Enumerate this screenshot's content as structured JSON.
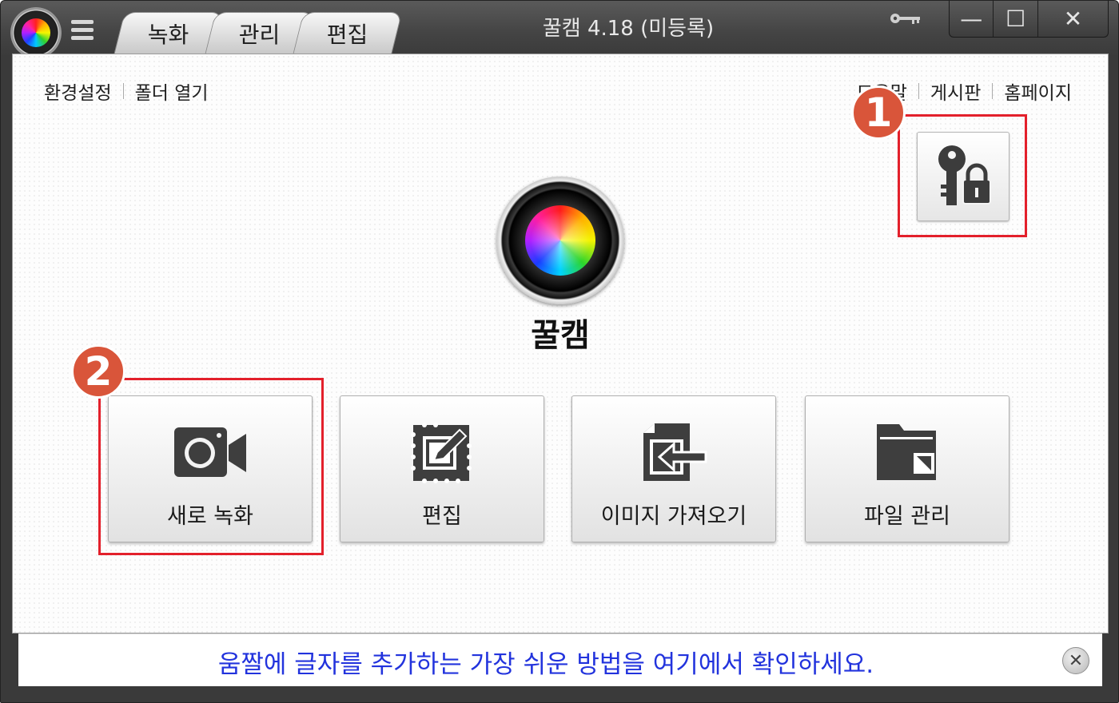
{
  "window": {
    "title": "꿀캠 4.18 (미등록)",
    "tabs": [
      "녹화",
      "관리",
      "편집"
    ],
    "caption": {
      "minimize": "—",
      "maximize": "☐",
      "close": "✕"
    }
  },
  "links": {
    "left": [
      "환경설정",
      "폴더 열기"
    ],
    "right": [
      "도움말",
      "게시판",
      "홈페이지"
    ]
  },
  "app_name": "꿀캠",
  "markers": [
    "1",
    "2"
  ],
  "actions": [
    {
      "label": "새로 녹화",
      "icon": "camera-icon"
    },
    {
      "label": "편집",
      "icon": "edit-stamp-icon"
    },
    {
      "label": "이미지 가져오기",
      "icon": "import-image-icon"
    },
    {
      "label": "파일 관리",
      "icon": "folder-icon"
    }
  ],
  "notice": {
    "text": "움짤에 글자를 추가하는 가장 쉬운 방법을 여기에서 확인하세요.",
    "close": "✕"
  },
  "colors": {
    "highlight": "#e3202b",
    "marker": "#d9553a",
    "notice_text": "#2233dd"
  }
}
